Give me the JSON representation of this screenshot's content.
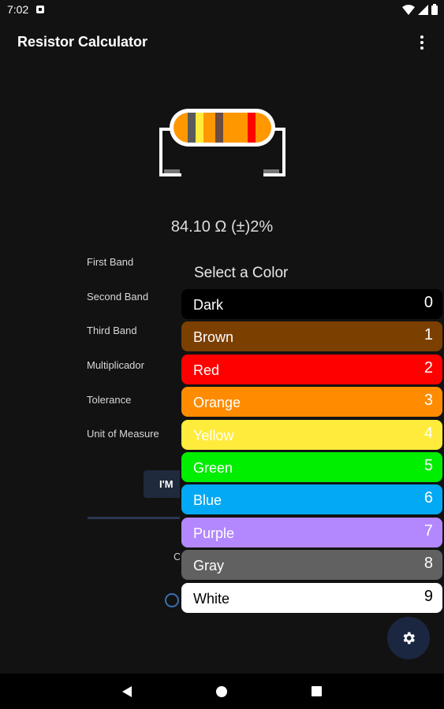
{
  "status_bar": {
    "time": "7:02",
    "notification_icon": "notification-icon",
    "wifi_icon": "wifi-icon",
    "signal_icon": "signal-icon",
    "battery_icon": "battery-icon"
  },
  "app_bar": {
    "title": "Resistor Calculator",
    "menu_icon": "more-vert-icon"
  },
  "resistor": {
    "bands": [
      {
        "color": "#5a5a5a"
      },
      {
        "color": "#ffeb3b"
      },
      {
        "color": "#ff9800"
      },
      {
        "color": "#6d4c41"
      },
      {
        "color": "#ff9800"
      },
      {
        "color": "#ff0000"
      }
    ],
    "body_color": "#ff9800"
  },
  "result": "84.10 Ω (±)2%",
  "form": {
    "labels": [
      "First Band",
      "Second Band",
      "Third Band",
      "Multiplicador",
      "Tolerance",
      "Unit of Measure"
    ],
    "button_label": "I'M",
    "partial_text": "C"
  },
  "color_picker": {
    "title": "Select a Color",
    "options": [
      {
        "name": "Dark",
        "digit": "0",
        "bg": "#000000",
        "fg": "#ffffff"
      },
      {
        "name": "Brown",
        "digit": "1",
        "bg": "#7b3f00",
        "fg": "#ffffff"
      },
      {
        "name": "Red",
        "digit": "2",
        "bg": "#ff0000",
        "fg": "#ffffff"
      },
      {
        "name": "Orange",
        "digit": "3",
        "bg": "#ff8c00",
        "fg": "#ffffff"
      },
      {
        "name": "Yellow",
        "digit": "4",
        "bg": "#ffeb3b",
        "fg": "#ffffff"
      },
      {
        "name": "Green",
        "digit": "5",
        "bg": "#00ee00",
        "fg": "#ffffff"
      },
      {
        "name": "Blue",
        "digit": "6",
        "bg": "#03a9f4",
        "fg": "#ffffff"
      },
      {
        "name": "Purple",
        "digit": "7",
        "bg": "#b388ff",
        "fg": "#ffffff"
      },
      {
        "name": "Gray",
        "digit": "8",
        "bg": "#616161",
        "fg": "#ffffff"
      },
      {
        "name": "White",
        "digit": "9",
        "bg": "#ffffff",
        "fg": "#000000"
      }
    ]
  },
  "fab": {
    "icon": "settings-icon"
  },
  "nav_bar": {
    "back_icon": "back-icon",
    "home_icon": "home-icon",
    "recents_icon": "recents-icon"
  }
}
